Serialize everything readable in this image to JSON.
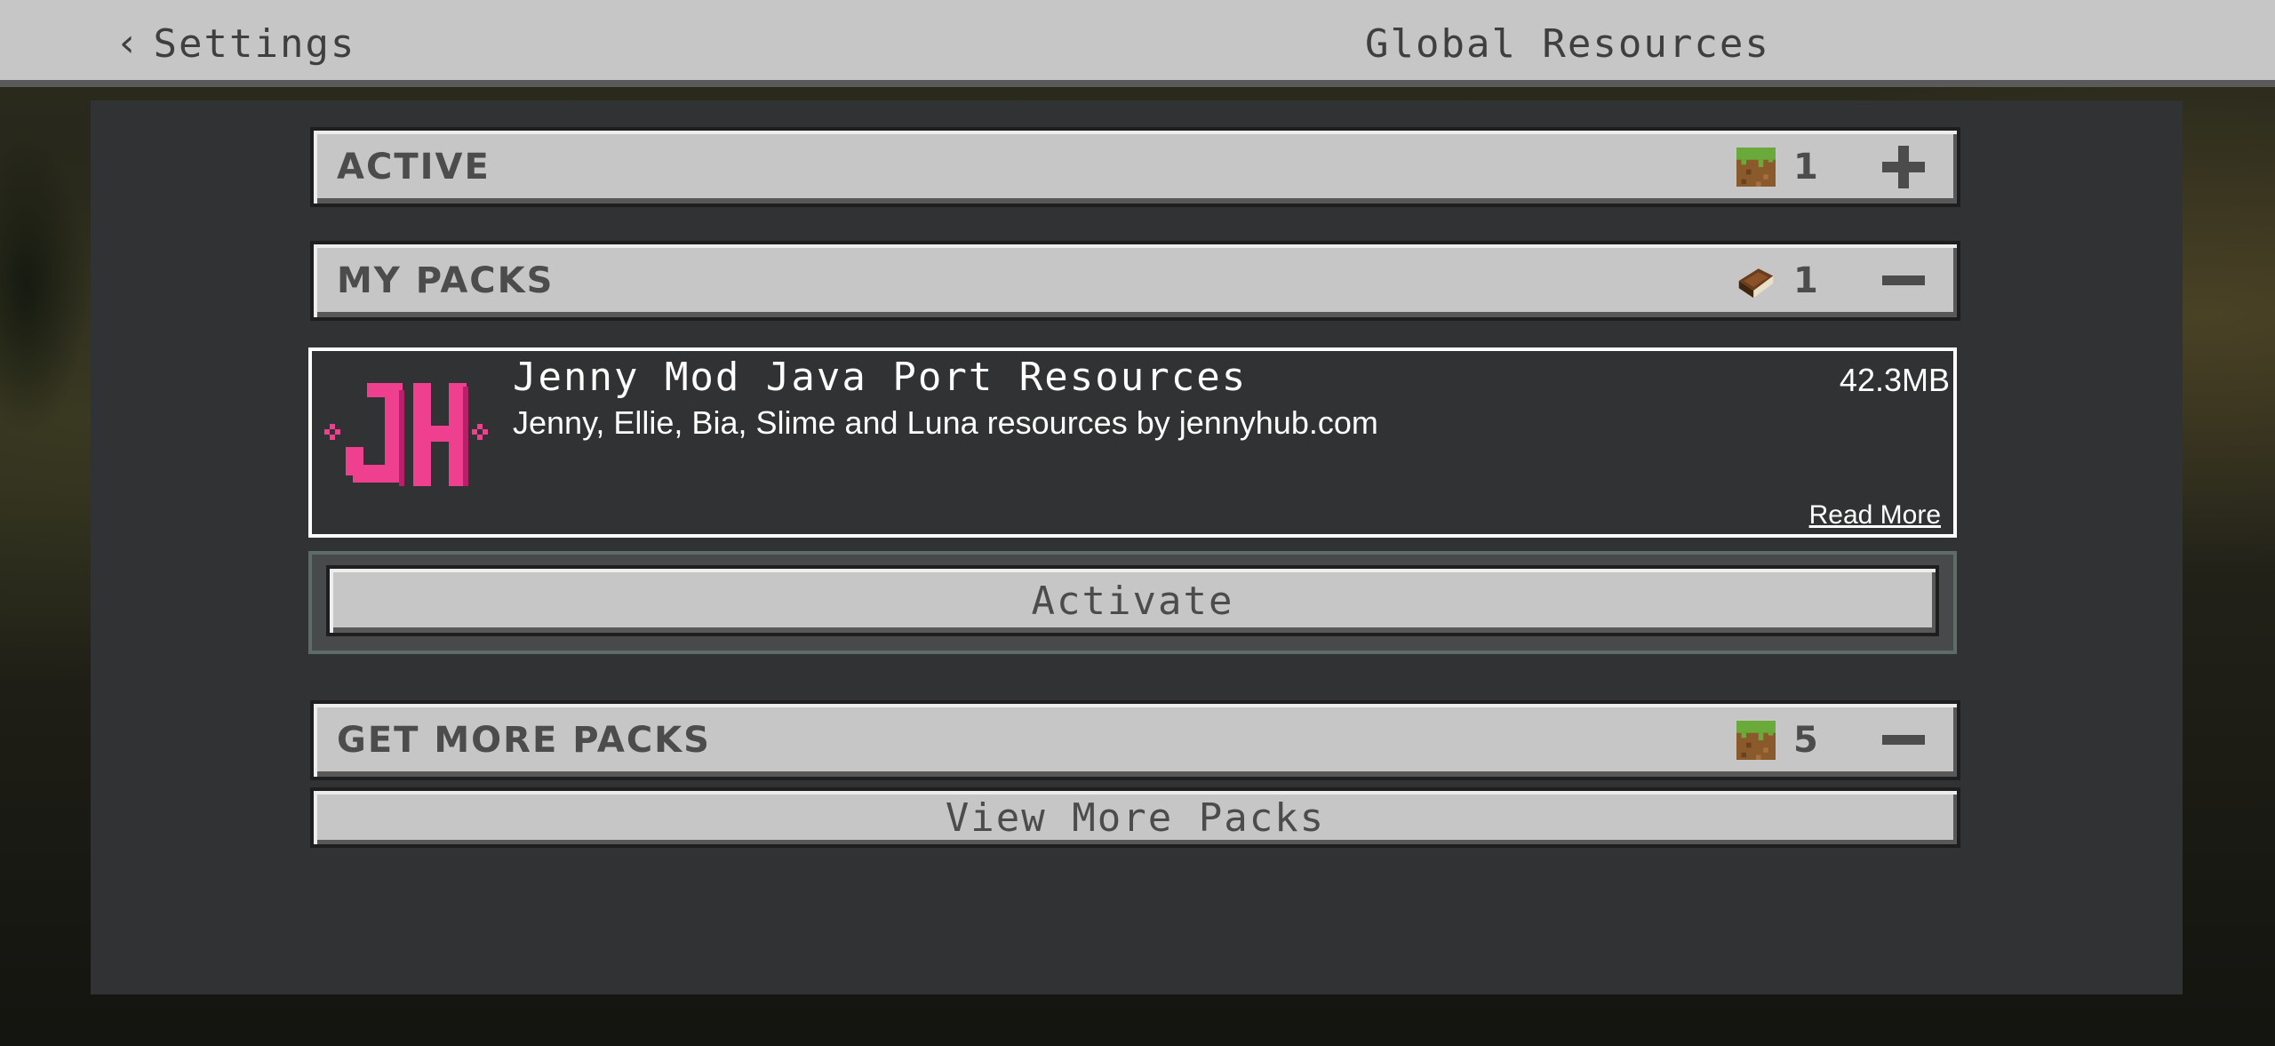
{
  "topbar": {
    "back_label": "Settings",
    "title": "Global Resources"
  },
  "sections": {
    "active": {
      "label": "ACTIVE",
      "count": "1",
      "icon": "grass-block-icon",
      "action": "plus-icon"
    },
    "my_packs": {
      "label": "MY PACKS",
      "count": "1",
      "icon": "book-icon",
      "action": "minus-icon"
    },
    "get_more": {
      "label": "GET MORE PACKS",
      "count": "5",
      "icon": "grass-block-icon",
      "action": "minus-icon"
    }
  },
  "pack": {
    "name": "Jenny Mod Java Port Resources",
    "description": "Jenny, Ellie, Bia, Slime and Luna resources by jennyhub.com",
    "size": "42.3MB",
    "read_more": "Read More",
    "logo_text": "JH",
    "logo_color": "#ef3f8f"
  },
  "buttons": {
    "activate": "Activate",
    "view_more": "View More Packs"
  },
  "colors": {
    "panel": "#313233",
    "button": "#c6c6c6",
    "text_dark": "#4c4c4c"
  }
}
